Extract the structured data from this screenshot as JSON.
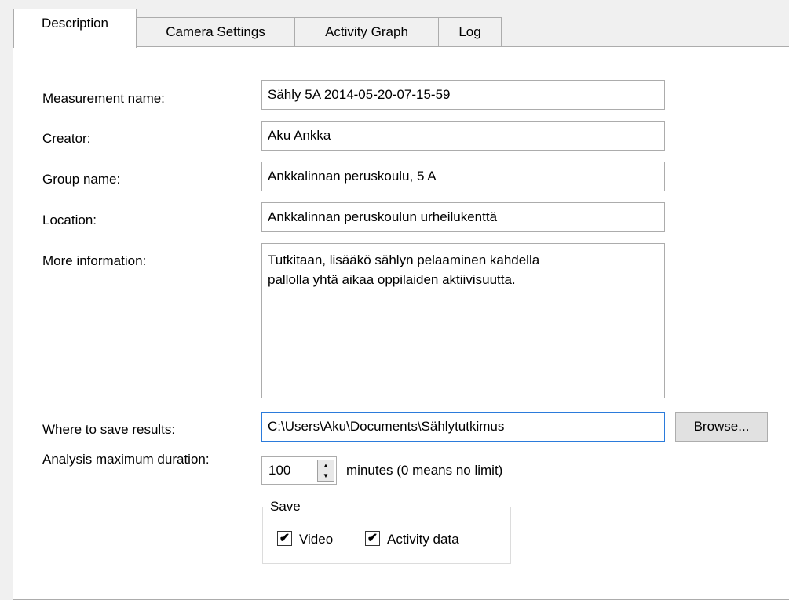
{
  "tabs": [
    {
      "label": "Description",
      "active": true
    },
    {
      "label": "Camera Settings",
      "active": false
    },
    {
      "label": "Activity Graph",
      "active": false
    },
    {
      "label": "Log",
      "active": false
    }
  ],
  "form": {
    "measurement_name": {
      "label": "Measurement name:",
      "value": "Sähly 5A 2014-05-20-07-15-59"
    },
    "creator": {
      "label": "Creator:",
      "value": "Aku Ankka"
    },
    "group_name": {
      "label": "Group name:",
      "value": "Ankkalinnan peruskoulu, 5 A"
    },
    "location": {
      "label": "Location:",
      "value": "Ankkalinnan peruskoulun urheilukenttä"
    },
    "more_information": {
      "label": "More information:",
      "value": "Tutkitaan, lisääkö sählyn pelaaminen kahdella\npallolla yhtä aikaa oppilaiden aktiivisuutta."
    },
    "save_path": {
      "label": "Where to save results:",
      "value": "C:\\Users\\Aku\\Documents\\Sählytutkimus"
    },
    "browse_label": "Browse...",
    "duration": {
      "label": "Analysis maximum duration:",
      "value": "100",
      "suffix": "minutes (0 means no limit)"
    },
    "save_group": {
      "title": "Save",
      "video": {
        "label": "Video",
        "checked": true
      },
      "activity_data": {
        "label": "Activity data",
        "checked": true
      }
    }
  },
  "icons": {
    "check": "✔",
    "spin_up": "▲",
    "spin_down": "▼"
  }
}
